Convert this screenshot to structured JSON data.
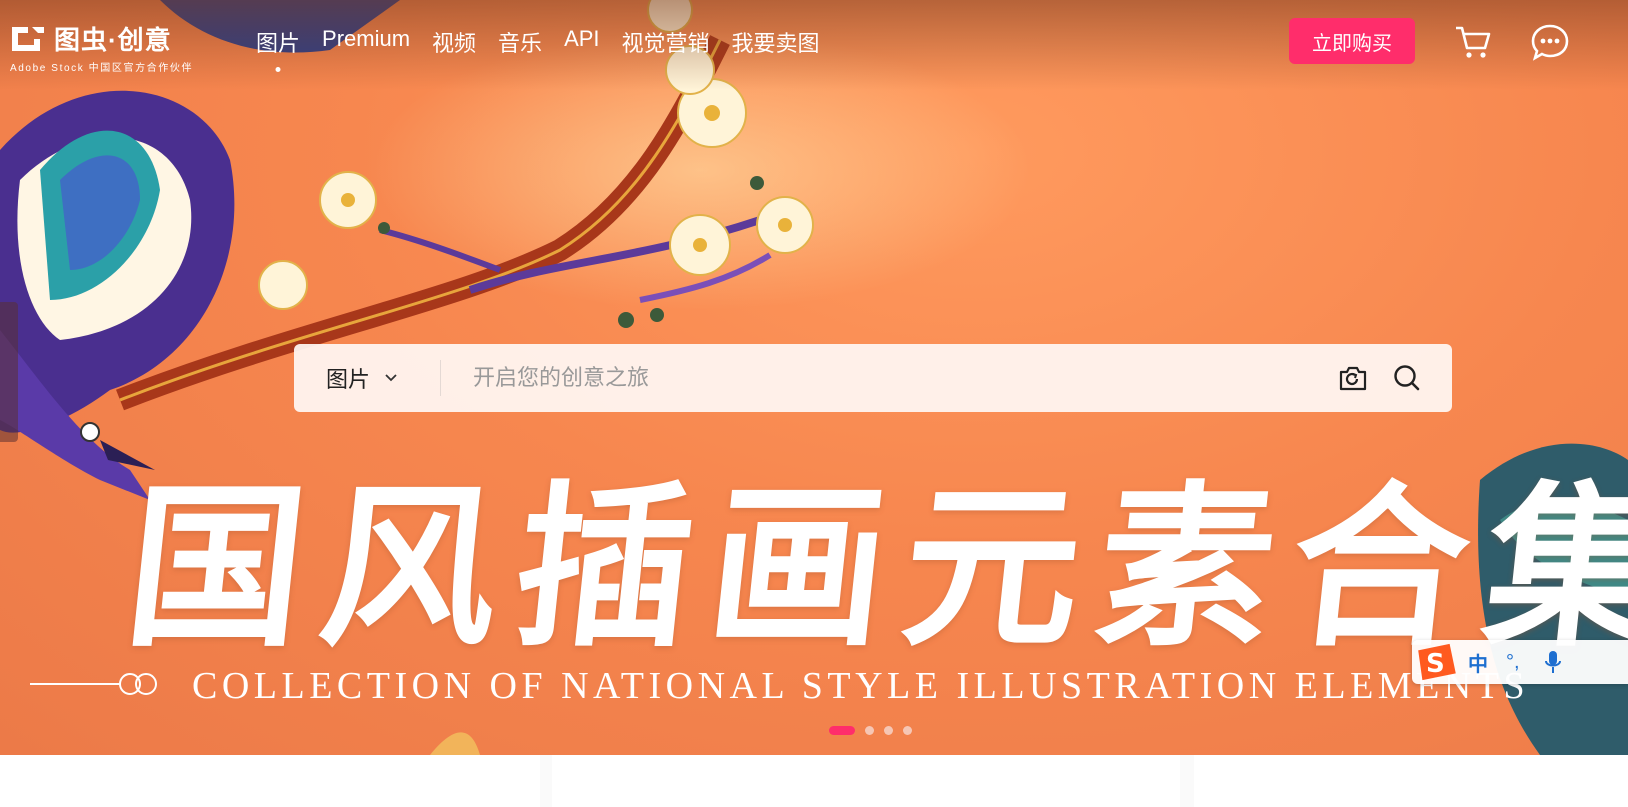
{
  "logo": {
    "name": "图虫·创意",
    "tagline": "Adobe  Stock 中国区官方合作伙伴"
  },
  "nav": {
    "items": [
      {
        "label": "图片",
        "active": true
      },
      {
        "label": "Premium"
      },
      {
        "label": "视频"
      },
      {
        "label": "音乐"
      },
      {
        "label": "API"
      },
      {
        "label": "视觉营销"
      },
      {
        "label": "我要卖图"
      }
    ]
  },
  "header": {
    "buy_label": "立即购买",
    "cart_icon": "cart-icon",
    "chat_icon": "chat-icon"
  },
  "search": {
    "type_label": "图片",
    "placeholder": "开启您的创意之旅",
    "camera_icon": "camera-icon",
    "search_icon": "search-icon"
  },
  "banner": {
    "headline": "国风插画元素合集",
    "subtitle": "COLLECTION OF NATIONAL STYLE ILLUSTRATION ELEMENTS",
    "slides_total": 4,
    "active_slide": 1
  },
  "ime": {
    "mode": "中",
    "punctuation": "°,",
    "mic_icon": "microphone-icon"
  },
  "colors": {
    "accent": "#ff2d6b",
    "banner_bg": "#f7874f",
    "ime_blue": "#1e6fd0"
  }
}
